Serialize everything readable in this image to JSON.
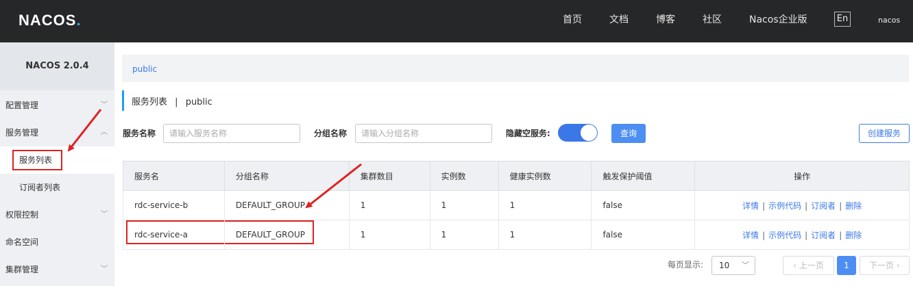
{
  "header": {
    "logo": "NACOS",
    "logo_dot": ".",
    "nav": [
      {
        "label": "首页"
      },
      {
        "label": "文档"
      },
      {
        "label": "博客"
      },
      {
        "label": "社区"
      },
      {
        "label": "Nacos企业版"
      }
    ],
    "lang": "En",
    "user": "nacos"
  },
  "sidebar": {
    "title": "NACOS 2.0.4",
    "items": [
      {
        "label": "配置管理"
      },
      {
        "label": "服务管理"
      },
      {
        "label": "服务列表"
      },
      {
        "label": "订阅者列表"
      },
      {
        "label": "权限控制"
      },
      {
        "label": "命名空间"
      },
      {
        "label": "集群管理"
      }
    ]
  },
  "breadcrumb": {
    "namespace": "public"
  },
  "page": {
    "title": "服务列表",
    "divider": "|",
    "namespace": "public"
  },
  "filters": {
    "service_label": "服务名称",
    "service_placeholder": "请输入服务名称",
    "group_label": "分组名称",
    "group_placeholder": "请输入分组名称",
    "hide_empty_label": "隐藏空服务:",
    "hide_empty_on": true,
    "query": "查询",
    "create": "创建服务"
  },
  "table": {
    "headers": [
      "服务名",
      "分组名称",
      "集群数目",
      "实例数",
      "健康实例数",
      "触发保护阈值",
      "操作"
    ],
    "rows": [
      {
        "service": "rdc-service-b",
        "group": "DEFAULT_GROUP",
        "clusters": "1",
        "instances": "1",
        "healthy": "1",
        "threshold": "false"
      },
      {
        "service": "rdc-service-a",
        "group": "DEFAULT_GROUP",
        "clusters": "1",
        "instances": "1",
        "healthy": "1",
        "threshold": "false"
      }
    ],
    "actions": [
      "详情",
      "示例代码",
      "订阅者",
      "删除"
    ],
    "action_sep": "|"
  },
  "pagination": {
    "per_page_label": "每页显示:",
    "per_page": "10",
    "prev": "上一页",
    "current": "1",
    "next": "下一页"
  },
  "colors": {
    "accent": "#3b78e7",
    "highlight": "#e02020",
    "topbar": "#262729"
  }
}
